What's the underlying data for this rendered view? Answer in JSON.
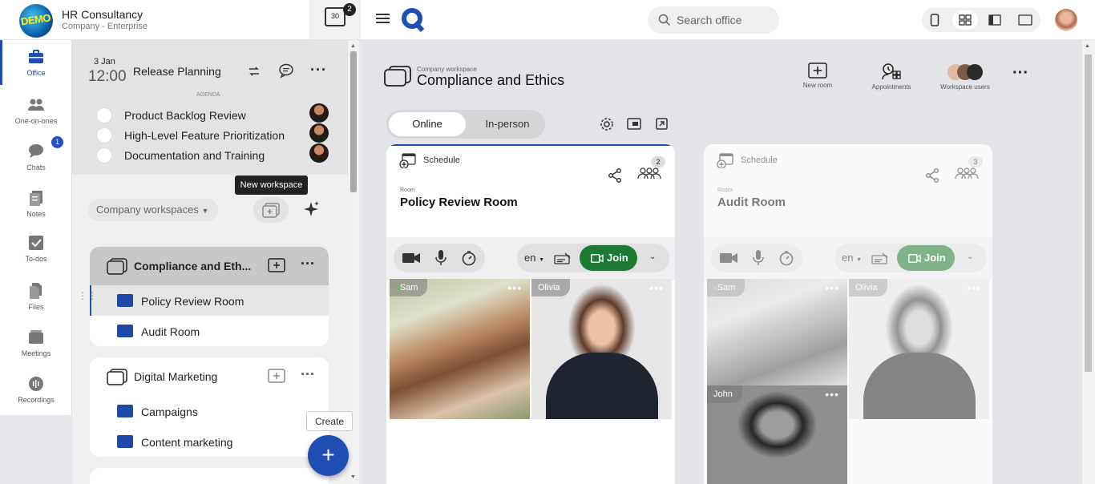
{
  "org": {
    "name": "HR Consultancy",
    "subtitle": "Company - Enterprise",
    "logo_text": "DEMO",
    "calendar_day": "30",
    "calendar_badge": "2"
  },
  "nav": {
    "items": [
      {
        "label": "Office"
      },
      {
        "label": "One-on-ones"
      },
      {
        "label": "Chats",
        "badge": "1"
      },
      {
        "label": "Notes"
      },
      {
        "label": "To-dos"
      },
      {
        "label": "Files"
      },
      {
        "label": "Meetings"
      },
      {
        "label": "Recordings"
      }
    ]
  },
  "meeting": {
    "date": "3 Jan",
    "time": "12:00",
    "title": "Release Planning",
    "agenda_label": "AGENDA",
    "agenda": [
      {
        "text": "Product Backlog Review"
      },
      {
        "text": "High-Level Feature Prioritization"
      },
      {
        "text": "Documentation and Training"
      }
    ]
  },
  "sidebar": {
    "tooltip": "New workspace",
    "filter_label": "Company workspaces",
    "workspaces": [
      {
        "title": "Compliance and Eth...",
        "rooms": [
          "Policy Review Room",
          "Audit Room"
        ]
      },
      {
        "title": "Digital Marketing",
        "rooms": [
          "Campaigns",
          "Content marketing"
        ]
      }
    ],
    "create_tooltip": "Create"
  },
  "topbar": {
    "search_placeholder": "Search office"
  },
  "workspace": {
    "subtitle": "Company workspace",
    "title": "Compliance and Ethics",
    "actions": {
      "new_room": "New room",
      "appointments": "Appointments",
      "workspace_users": "Workspace users"
    },
    "tabs": {
      "online": "Online",
      "in_person": "In-person"
    }
  },
  "rooms": [
    {
      "schedule": "Schedule",
      "room_label": "Room",
      "title": "Policy Review Room",
      "count": "2",
      "lang": "en",
      "join": "Join",
      "participants": [
        {
          "name": "Sam"
        },
        {
          "name": "Olivia"
        }
      ]
    },
    {
      "schedule": "Schedule",
      "room_label": "Room",
      "title": "Audit Room",
      "count": "3",
      "lang": "en",
      "join": "Join",
      "participants": [
        {
          "name": "Sam"
        },
        {
          "name": "Olivia"
        },
        {
          "name": "John"
        }
      ]
    }
  ],
  "colors": {
    "accent": "#1f4fb4",
    "join_green": "#1d7a34",
    "room_square": "#1f48a8"
  }
}
